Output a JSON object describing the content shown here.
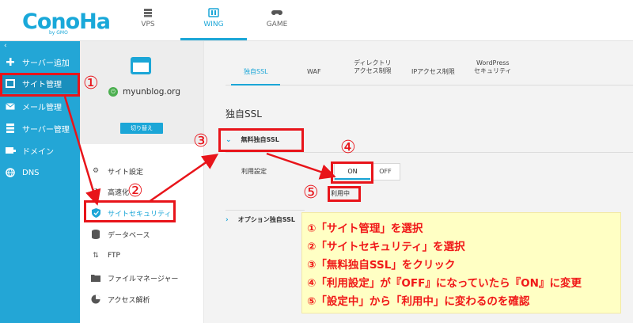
{
  "brand": {
    "logo": "ConoHa",
    "logo_sub": "by GMO"
  },
  "top_tabs": [
    {
      "label": "VPS",
      "icon": "server-icon"
    },
    {
      "label": "WING",
      "icon": "wing-icon"
    },
    {
      "label": "GAME",
      "icon": "gamepad-icon"
    }
  ],
  "sidebar": {
    "items": [
      {
        "label": "サーバー追加",
        "icon": "plus-icon"
      },
      {
        "label": "サイト管理",
        "icon": "window-icon"
      },
      {
        "label": "メール管理",
        "icon": "mail-icon"
      },
      {
        "label": "サーバー管理",
        "icon": "server-icon"
      },
      {
        "label": "ドメイン",
        "icon": "domain-icon"
      },
      {
        "label": "DNS",
        "icon": "globe-icon"
      }
    ]
  },
  "site": {
    "domain": "myunblog.org",
    "switch_label": "切り替え"
  },
  "site_menu": [
    {
      "label": "サイト設定",
      "icon": "settings-icon"
    },
    {
      "label": "高速化",
      "icon": "speed-icon"
    },
    {
      "label": "サイトセキュリティ",
      "icon": "shield-icon"
    },
    {
      "label": "データベース",
      "icon": "database-icon"
    },
    {
      "label": "FTP",
      "icon": "transfer-icon"
    },
    {
      "label": "ファイルマネージャー",
      "icon": "folder-icon"
    },
    {
      "label": "アクセス解析",
      "icon": "pie-icon"
    }
  ],
  "content_tabs": [
    {
      "line1": "独自SSL",
      "line2": ""
    },
    {
      "line1": "WAF",
      "line2": ""
    },
    {
      "line1": "ディレクトリ",
      "line2": "アクセス制限"
    },
    {
      "line1": "IPアクセス制限",
      "line2": ""
    },
    {
      "line1": "WordPress",
      "line2": "セキュリティ"
    }
  ],
  "ssl": {
    "title": "独自SSL",
    "free_ssl_label": "無料独自SSL",
    "option_ssl_label": "オプション独自SSL",
    "use_setting_label": "利用設定",
    "toggle_on": "ON",
    "toggle_off": "OFF",
    "status": "利用中"
  },
  "annotations": {
    "markers": [
      "①",
      "②",
      "③",
      "④",
      "⑤"
    ],
    "steps": [
      "①「サイト管理」を選択",
      "②「サイトセキュリティ」を選択",
      "③「無料独自SSL」をクリック",
      "④「利用設定」が『OFF』になっていたら『ON』に変更",
      "⑤「設定中」から「利用中」に変わるのを確認"
    ]
  },
  "colors": {
    "accent": "#1ba6d7",
    "sidebar": "#23a6d6",
    "annotation_red": "#e8141a",
    "note_bg": "#ffffc4"
  }
}
